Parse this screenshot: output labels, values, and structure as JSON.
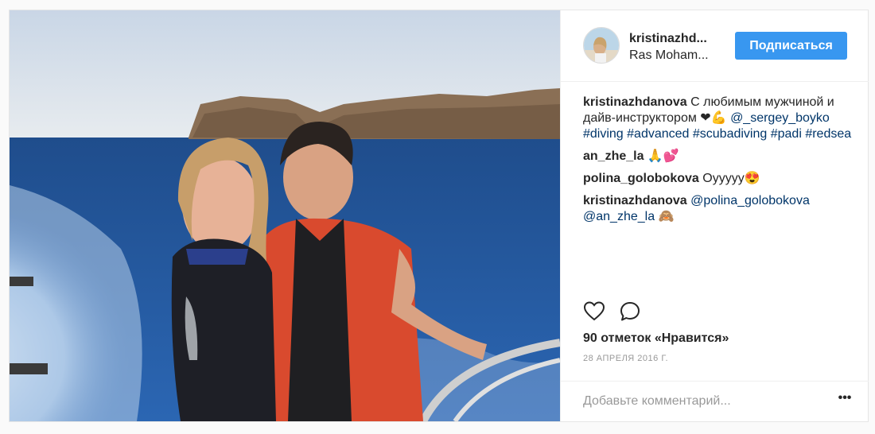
{
  "header": {
    "username": "kristinazhd...",
    "location": "Ras Moham...",
    "follow_label": "Подписаться"
  },
  "comments": [
    {
      "user": "kristinazhdanova",
      "text": " С любимым мужчиной и дайв-инструктором ❤💪 ",
      "tags": "@_sergey_boyko #diving #advanced #scubadiving #padi #redsea"
    },
    {
      "user": "an_zhe_la",
      "text": " 🙏💕",
      "tags": ""
    },
    {
      "user": "polina_golobokova",
      "text": " Oyyyyy😍",
      "tags": ""
    },
    {
      "user": "kristinazhdanova",
      "text": " ",
      "tags": "@polina_golobokova @an_zhe_la",
      "emoji": " 🙈"
    }
  ],
  "actions": {
    "like_icon": "heart-icon",
    "comment_icon": "comment-bubble-icon"
  },
  "likes_text": "90 отметок «Нравится»",
  "date_text": "28 АПРЕЛЯ 2016 Г.",
  "add_comment": {
    "placeholder": "Добавьте комментарий...",
    "more_label": "•••"
  },
  "colors": {
    "follow_button": "#3897f0",
    "hashtag": "#003569",
    "meta_text": "#999999"
  }
}
